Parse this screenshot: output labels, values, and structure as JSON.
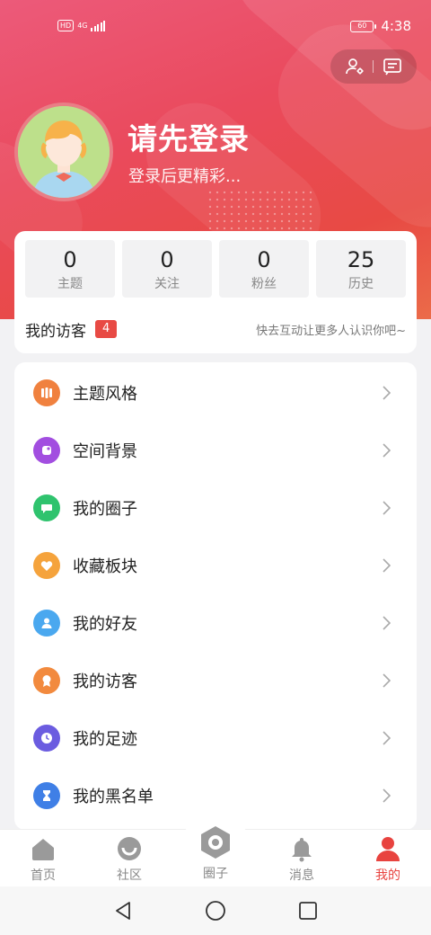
{
  "status_bar": {
    "network": "HD",
    "signal": "4G",
    "battery": "60",
    "time": "4:38"
  },
  "profile": {
    "title": "请先登录",
    "subtitle": "登录后更精彩..."
  },
  "stats": [
    {
      "value": "0",
      "label": "主题"
    },
    {
      "value": "0",
      "label": "关注"
    },
    {
      "value": "0",
      "label": "粉丝"
    },
    {
      "value": "25",
      "label": "历史"
    }
  ],
  "visitors": {
    "title": "我的访客",
    "count": "4",
    "hint": "快去互动让更多人认识你吧~"
  },
  "menu": [
    {
      "label": "主题风格",
      "icon": "theme-style-icon",
      "color": "#f0813f"
    },
    {
      "label": "空间背景",
      "icon": "space-background-icon",
      "color": "#a24ee0"
    },
    {
      "label": "我的圈子",
      "icon": "circle-chat-icon",
      "color": "#2fc36e"
    },
    {
      "label": "收藏板块",
      "icon": "heart-icon",
      "color": "#f5a33c"
    },
    {
      "label": "我的好友",
      "icon": "friend-icon",
      "color": "#4aa8ef"
    },
    {
      "label": "我的访客",
      "icon": "visitor-badge-icon",
      "color": "#f28a3e"
    },
    {
      "label": "我的足迹",
      "icon": "clock-icon",
      "color": "#6b5ce0"
    },
    {
      "label": "我的黑名单",
      "icon": "hourglass-icon",
      "color": "#3f7fe6"
    }
  ],
  "tabs": [
    {
      "label": "首页",
      "icon": "home-icon"
    },
    {
      "label": "社区",
      "icon": "community-icon"
    },
    {
      "label": "圈子",
      "icon": "hexagon-icon"
    },
    {
      "label": "消息",
      "icon": "bell-icon"
    },
    {
      "label": "我的",
      "icon": "profile-icon"
    }
  ],
  "colors": {
    "accent": "#e8433f",
    "tab_inactive": "#888888"
  }
}
